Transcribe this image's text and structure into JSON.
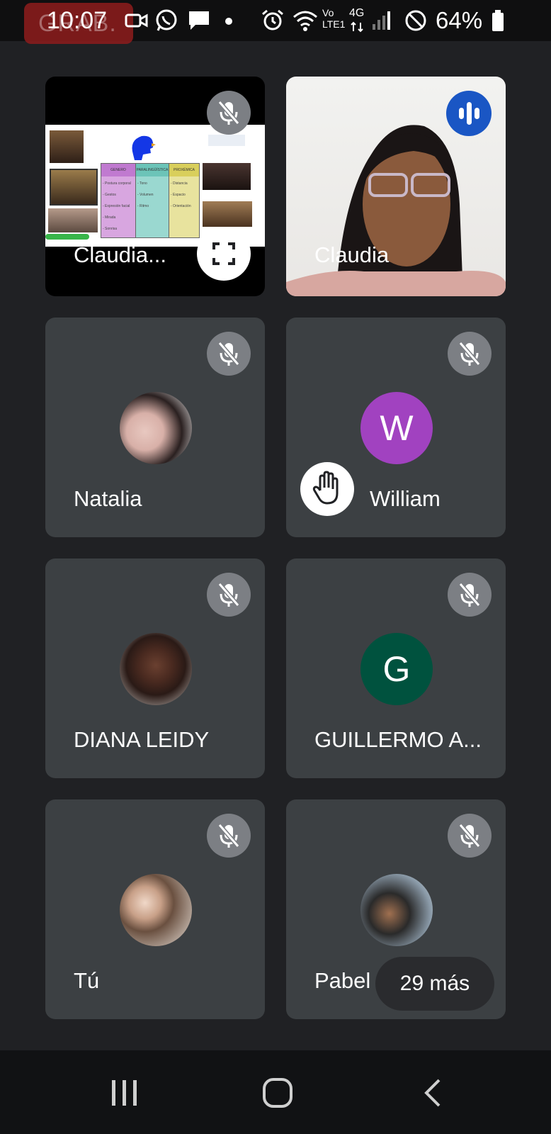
{
  "status": {
    "time": "10:07",
    "rec_ghost": "GRAB.",
    "battery": "64%",
    "net_vo": "Vo",
    "net_lte": "LTE1",
    "net_4g": "4G"
  },
  "tiles": [
    {
      "name": "Claudia...",
      "kind": "presentation"
    },
    {
      "name": "Claudia",
      "kind": "video",
      "speaking": true
    },
    {
      "name": "Natalia",
      "kind": "photo"
    },
    {
      "name": "William",
      "kind": "letter",
      "letter": "W",
      "color": "#a142c0",
      "hand_raised": true
    },
    {
      "name": "DIANA LEIDY",
      "kind": "photo"
    },
    {
      "name": "GUILLERMO A...",
      "kind": "letter",
      "letter": "G",
      "color": "#00523e"
    },
    {
      "name": "Tú",
      "kind": "photo"
    },
    {
      "name": "Pabel",
      "kind": "photo"
    }
  ],
  "slide": {
    "col1": "GENERO",
    "col2": "PARALINGÜÍSTICA",
    "col3": "PROXÉMICA",
    "col1_items": [
      "- Postura corporal",
      "- Gestos",
      "- Expresión facial",
      "- Mirada",
      "- Sonrisa"
    ],
    "col2_items": [
      "- Tono",
      "- Volumen",
      "- Ritmo"
    ],
    "col3_items": [
      "- Distancia",
      "- Espacio",
      "- Orientación"
    ]
  },
  "more_label": "29 más",
  "colors": {
    "background": "#202124",
    "tile": "#3c4043",
    "speaking_badge": "#1a56c4",
    "mute_badge": "#7c7f84"
  }
}
